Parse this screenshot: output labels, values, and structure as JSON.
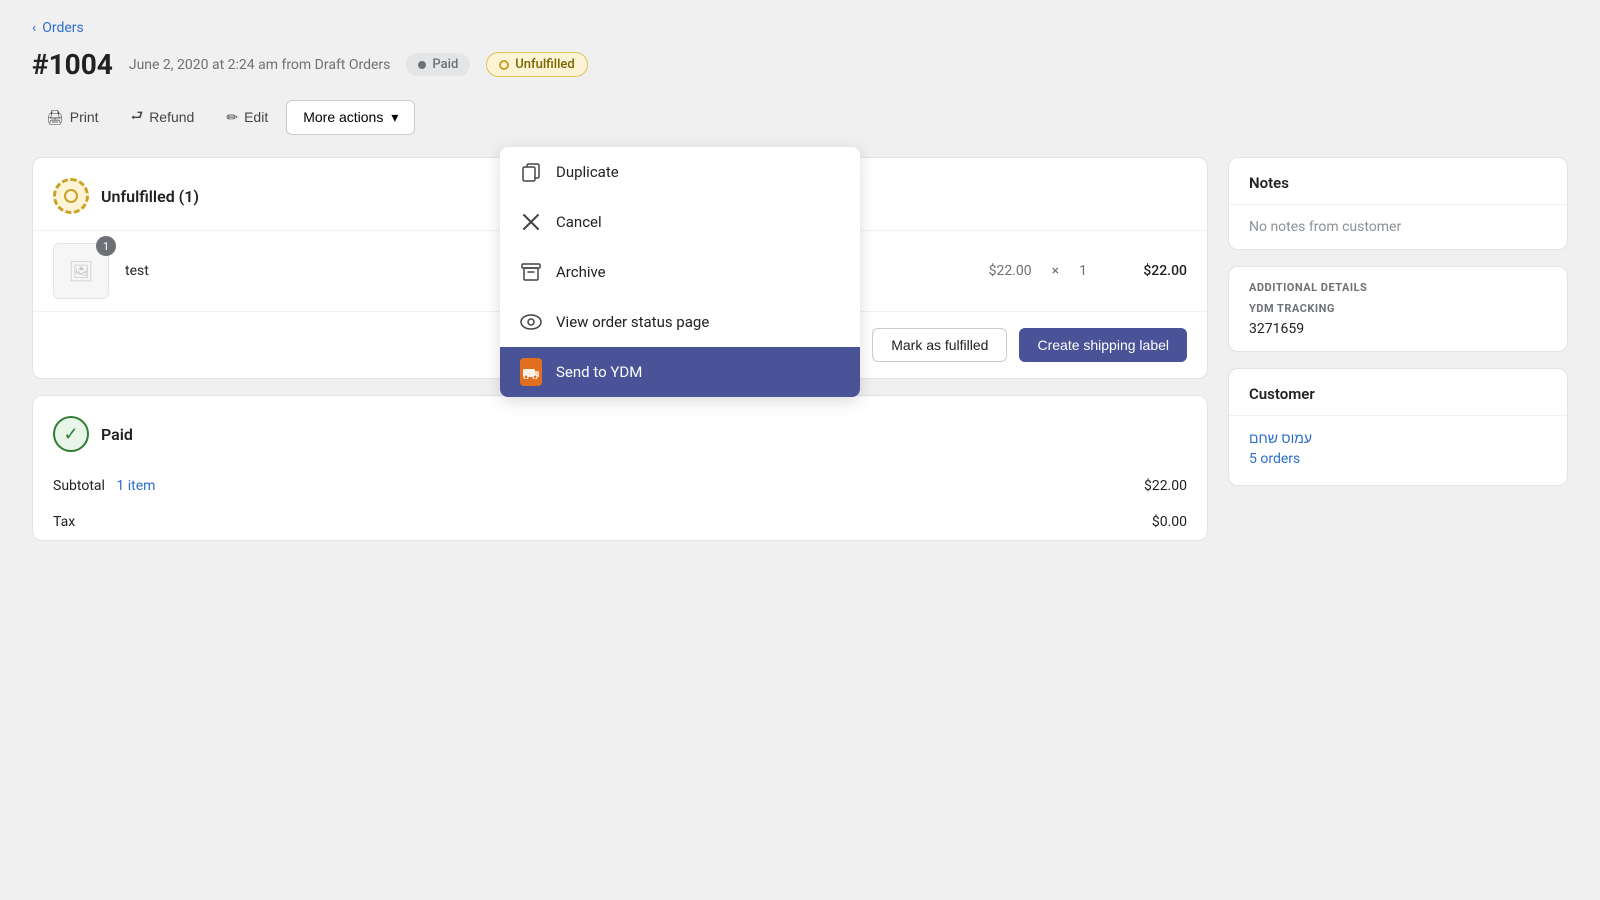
{
  "back": {
    "label": "Orders"
  },
  "header": {
    "order_number": "#1004",
    "meta": "June 2, 2020 at 2:24 am from Draft Orders",
    "badge_paid": "Paid",
    "badge_unfulfilled": "Unfulfilled"
  },
  "toolbar": {
    "print_label": "Print",
    "refund_label": "Refund",
    "edit_label": "Edit",
    "more_actions_label": "More actions"
  },
  "dropdown": {
    "items": [
      {
        "id": "duplicate",
        "icon": "duplicate",
        "label": "Duplicate"
      },
      {
        "id": "cancel",
        "icon": "cancel",
        "label": "Cancel"
      },
      {
        "id": "archive",
        "icon": "archive",
        "label": "Archive"
      },
      {
        "id": "view-order-status",
        "icon": "eye",
        "label": "View order status page"
      },
      {
        "id": "send-ydm",
        "icon": "ydm",
        "label": "Send to YDM",
        "active": true
      }
    ]
  },
  "unfulfilled_section": {
    "title": "Unfulfilled (1)",
    "product": {
      "name": "test",
      "badge_count": "1",
      "price": "$22.00",
      "quantity": "1"
    },
    "mark_as_fulfilled_label": "Mark as fulfilled",
    "create_shipping_label": "Create shipping label"
  },
  "paid_section": {
    "title": "Paid",
    "subtotal_label": "Subtotal",
    "subtotal_items": "1 item",
    "subtotal_value": "$22.00",
    "tax_label": "Tax",
    "tax_value": "$0.00"
  },
  "notes": {
    "title": "Notes",
    "empty_text": "No notes from customer"
  },
  "additional": {
    "title": "ADDITIONAL DETAILS",
    "ydm_tracking_label": "YDM Tracking",
    "ydm_tracking_value": "3271659"
  },
  "customer": {
    "title": "Customer",
    "name": "עמוס שחם",
    "orders_count": "5 orders"
  }
}
